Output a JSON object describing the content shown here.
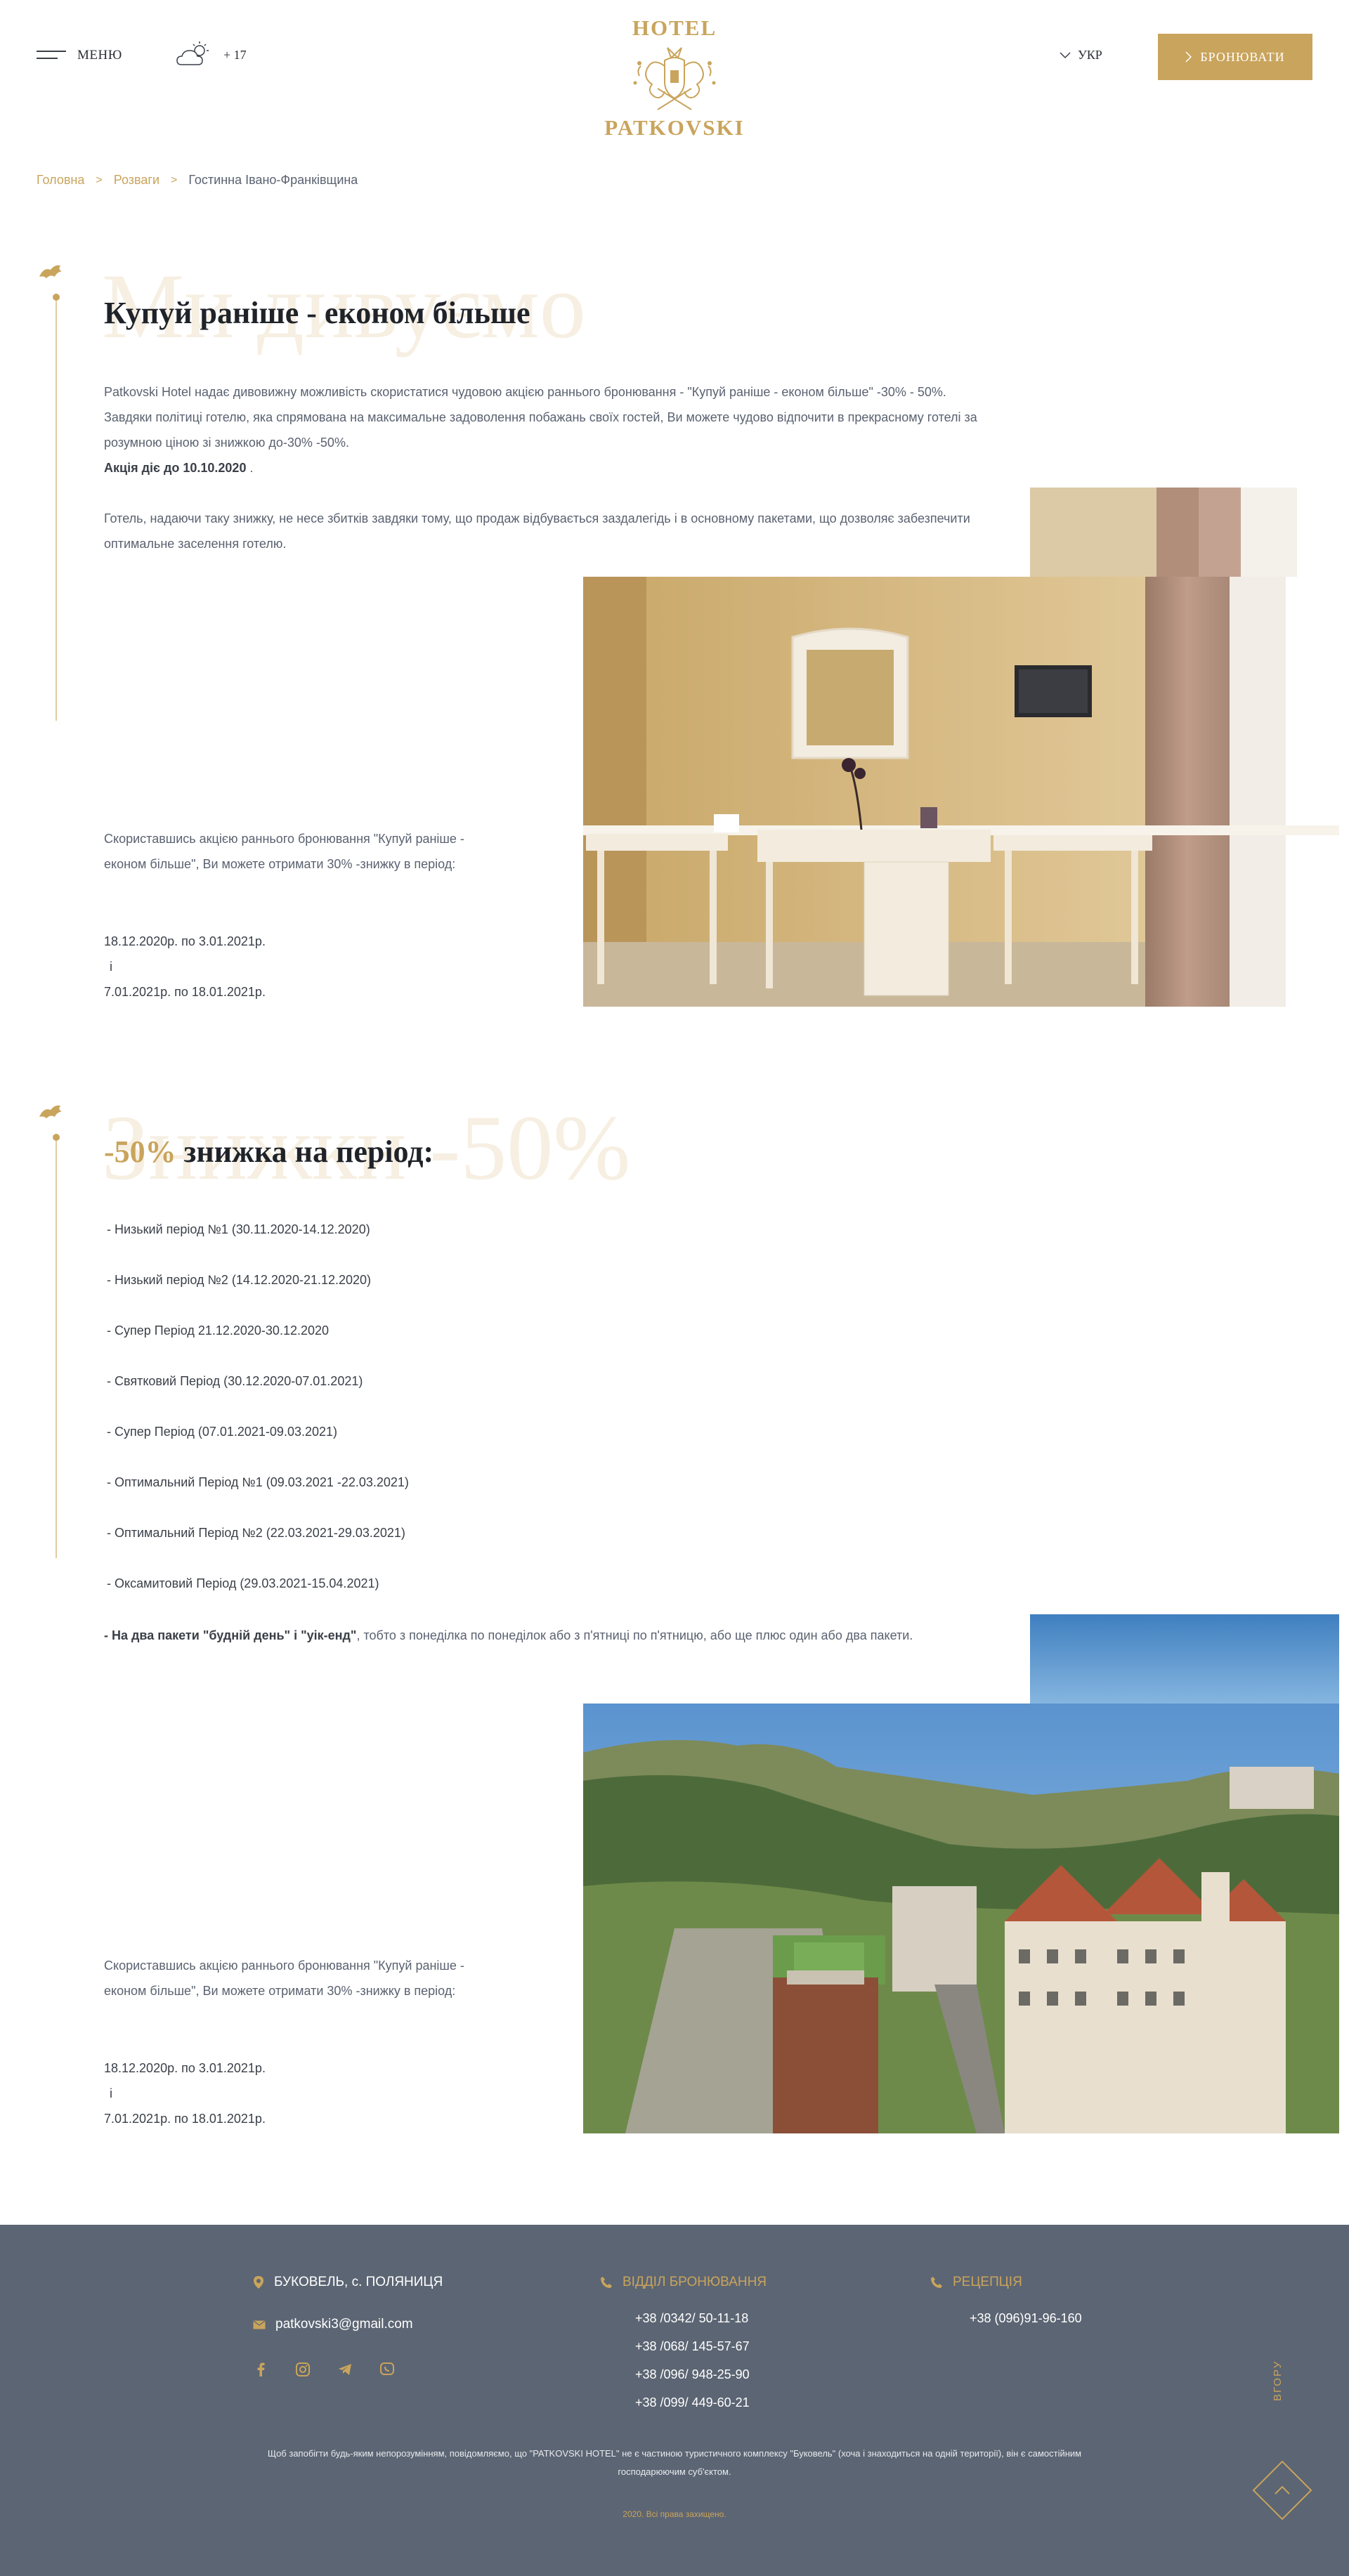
{
  "header": {
    "menu_label": "МЕНЮ",
    "weather_temp": "+ 17",
    "logo_top": "HOTEL",
    "logo_bottom": "PATKOVSKI",
    "lang": "УКР",
    "book_label": "БРОНЮВАТИ"
  },
  "breadcrumb": {
    "home": "Головна",
    "section": "Розваги",
    "current": "Гостинна Івано-Франківщина"
  },
  "section1": {
    "bg_word": "Ми дивуємо",
    "title": "Купуй раніше - економ більше",
    "p1": "Patkovski Hotel надає дивовижну можливість скористатися чудовою акцією раннього бронювання - \"Купуй раніше - економ більше\" -30% - 50%. Завдяки політиці готелю, яка спрямована на максимальне задоволення побажань своїх гостей, Ви можете чудово відпочити в прекрасному готелі за розумною ціною зі знижкою до-30% -50%.",
    "p1_bold": "Акція діє до 10.10.2020",
    "p1_tail": " .",
    "p2": "Готель, надаючи таку знижку, не несе збитків завдяки тому, що продаж відбувається заздалегідь і в основному пакетами, що дозволяє забезпечити оптимальне заселення готелю.",
    "side_text": "Скориставшись акцією раннього бронювання \"Купуй раніше - економ більше\", Ви можете отримати 30% -знижку в період:",
    "date1": "18.12.2020р. по 3.01.2021р.",
    "date_and": "і",
    "date2": "7.01.2021р. по 18.01.2021р."
  },
  "section2": {
    "bg_word": "Знижки -50%",
    "title_accent": "-50%",
    "title_rest": " знижка на період:",
    "periods": [
      "- Низький період №1 (30.11.2020-14.12.2020)",
      "- Низький період №2 (14.12.2020-21.12.2020)",
      "- Супер Період 21.12.2020-30.12.2020",
      "- Святковий Період (30.12.2020-07.01.2021)",
      "- Супер Період (07.01.2021-09.03.2021)",
      "- Оптимальний Період №1 (09.03.2021 -22.03.2021)",
      "- Оптимальний Період №2 (22.03.2021-29.03.2021)",
      "- Оксамитовий Період (29.03.2021-15.04.2021)"
    ],
    "package_bold": "- На два пакети \"будній день\" і \"уік-енд\"",
    "package_rest": ", тобто з понеділка по понеділок або з п'ятниці по п'ятницю, або ще плюс один або два пакети.",
    "side_text": "Скориставшись акцією раннього бронювання \"Купуй раніше - економ більше\", Ви можете отримати 30% -знижку в період:",
    "date1": "18.12.2020р. по 3.01.2021р.",
    "date_and": "і",
    "date2": "7.01.2021р. по 18.01.2021р."
  },
  "footer": {
    "address": "БУКОВЕЛЬ, с. ПОЛЯНИЦЯ",
    "email": "patkovski3@gmail.com",
    "booking_head": "ВІДДІЛ БРОНЮВАННЯ",
    "booking_phones": [
      "+38 /0342/ 50-11-18",
      "+38 /068/ 145-57-67",
      "+38 /096/ 948-25-90",
      "+38 /099/ 449-60-21"
    ],
    "reception_head": "РЕЦЕПЦІЯ",
    "reception_phone": "+38 (096)91-96-160",
    "note": "Щоб запобігти будь-яким непорозумінням, повідомляємо, що \"PATKOVSKI HOTEL\" не є частиною туристичного комплексу \"Буковель\" (хоча і знаходиться на одній території), він є самостійним господарюючим суб'єктом.",
    "copyright": "2020. Всі права захищено.",
    "to_top": "ВГОРУ"
  },
  "colors": {
    "accent": "#c9a45c",
    "footer_bg": "#5c6573",
    "text": "#5a6270",
    "heading": "#1f2329"
  },
  "icons": [
    "menu-icon",
    "weather-cloud-sun-icon",
    "chevron-down-icon",
    "chevron-right-icon",
    "location-pin-icon",
    "email-icon",
    "phone-icon",
    "facebook-icon",
    "instagram-icon",
    "telegram-icon",
    "viber-icon",
    "arrow-up-icon",
    "hotel-crest-icon",
    "deer-antler-icon"
  ]
}
